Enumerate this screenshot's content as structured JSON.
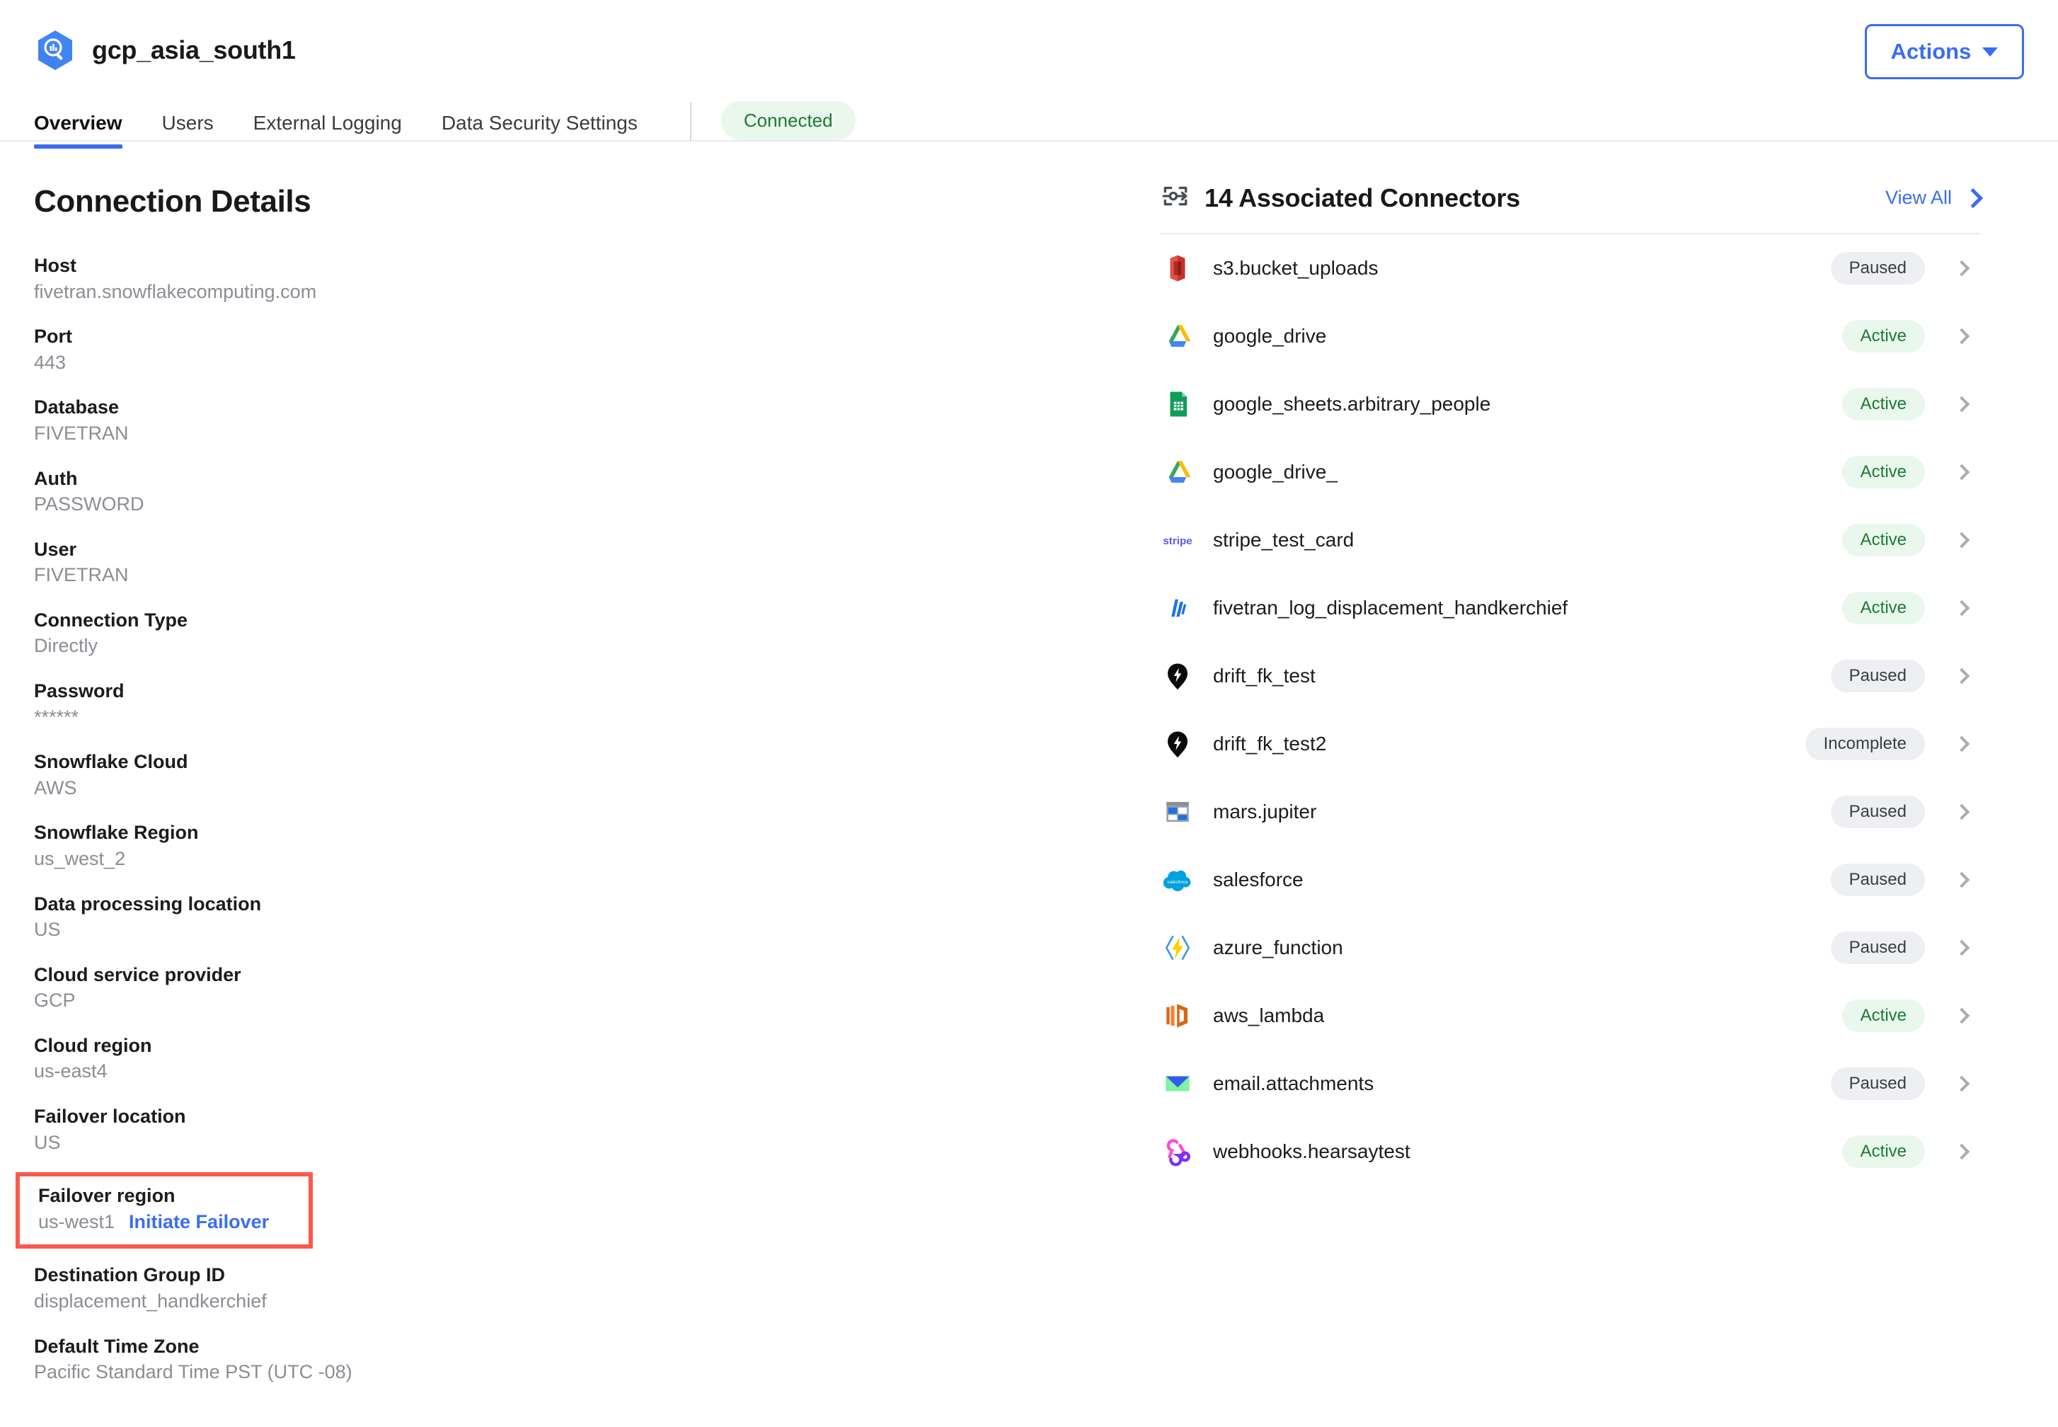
{
  "header": {
    "destination_icon": "bigquery-icon",
    "title": "gcp_asia_south1",
    "actions_label": "Actions",
    "connection_status": "Connected",
    "tabs": [
      {
        "label": "Overview",
        "active": true
      },
      {
        "label": "Users",
        "active": false
      },
      {
        "label": "External Logging",
        "active": false
      },
      {
        "label": "Data Security Settings",
        "active": false
      }
    ]
  },
  "connection_details": {
    "title": "Connection Details",
    "items": [
      {
        "label": "Host",
        "value": "fivetran.snowflakecomputing.com"
      },
      {
        "label": "Port",
        "value": "443"
      },
      {
        "label": "Database",
        "value": "FIVETRAN"
      },
      {
        "label": "Auth",
        "value": "PASSWORD"
      },
      {
        "label": "User",
        "value": "FIVETRAN"
      },
      {
        "label": "Connection Type",
        "value": "Directly"
      },
      {
        "label": "Password",
        "value": "******"
      },
      {
        "label": "Snowflake Cloud",
        "value": "AWS"
      },
      {
        "label": "Snowflake Region",
        "value": "us_west_2"
      },
      {
        "label": "Data processing location",
        "value": "US"
      },
      {
        "label": "Cloud service provider",
        "value": "GCP"
      },
      {
        "label": "Cloud region",
        "value": "us-east4"
      },
      {
        "label": "Failover location",
        "value": "US"
      }
    ],
    "failover_region": {
      "label": "Failover region",
      "value": "us-west1",
      "action_label": "Initiate Failover",
      "highlight_color": "#fa5a4b"
    },
    "trailing_items": [
      {
        "label": "Destination Group ID",
        "value": "displacement_handkerchief"
      },
      {
        "label": "Default Time Zone",
        "value": "Pacific Standard Time PST (UTC -08)"
      }
    ]
  },
  "connectors_panel": {
    "icon": "connector-transfer-icon",
    "title": "14 Associated Connectors",
    "view_all_label": "View All",
    "rows": [
      {
        "icon": "aws-s3-icon",
        "name": "s3.bucket_uploads",
        "status": "Paused"
      },
      {
        "icon": "google-drive-icon",
        "name": "google_drive",
        "status": "Active"
      },
      {
        "icon": "google-sheets-icon",
        "name": "google_sheets.arbitrary_people",
        "status": "Active"
      },
      {
        "icon": "google-drive-icon",
        "name": "google_drive_",
        "status": "Active"
      },
      {
        "icon": "stripe-icon",
        "name": "stripe_test_card",
        "status": "Active"
      },
      {
        "icon": "fivetran-icon",
        "name": "fivetran_log_displacement_handkerchief",
        "status": "Active"
      },
      {
        "icon": "drift-icon",
        "name": "drift_fk_test",
        "status": "Paused"
      },
      {
        "icon": "drift-icon",
        "name": "drift_fk_test2",
        "status": "Incomplete"
      },
      {
        "icon": "sharepoint-icon",
        "name": "mars.jupiter",
        "status": "Paused"
      },
      {
        "icon": "salesforce-icon",
        "name": "salesforce",
        "status": "Paused"
      },
      {
        "icon": "azure-function-icon",
        "name": "azure_function",
        "status": "Paused"
      },
      {
        "icon": "aws-lambda-icon",
        "name": "aws_lambda",
        "status": "Active"
      },
      {
        "icon": "email-icon",
        "name": "email.attachments",
        "status": "Paused"
      },
      {
        "icon": "webhooks-icon",
        "name": "webhooks.hearsaytest",
        "status": "Active"
      }
    ]
  },
  "colors": {
    "accent_blue": "#3a6df0",
    "status_active_bg": "#e9f7ec",
    "status_active_text": "#1d7a33",
    "status_paused_bg": "#eeeff3",
    "status_paused_text": "#3a3d44",
    "highlight_red": "#fa5a4b"
  }
}
